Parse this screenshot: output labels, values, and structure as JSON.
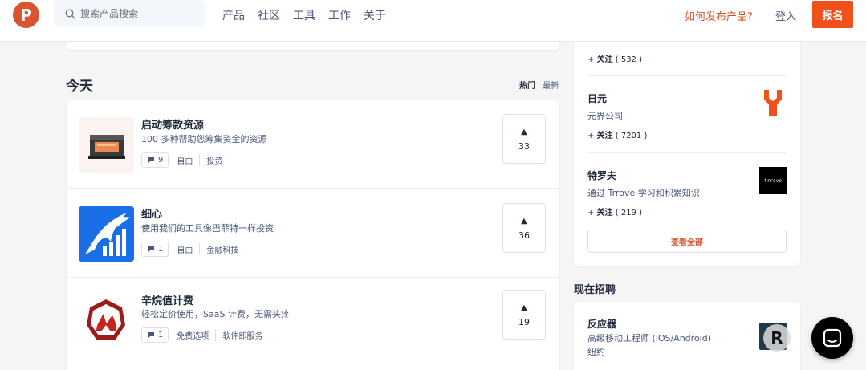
{
  "header": {
    "logo_letter": "P",
    "search_placeholder": "搜索产品搜索",
    "nav": [
      "产品",
      "社区",
      "工具",
      "工作",
      "关于"
    ],
    "how_to_post": "如何发布产品?",
    "login": "登入",
    "signup": "报名"
  },
  "feed": {
    "title": "今天",
    "sort_hot": "热门",
    "sort_new": "最新",
    "items": [
      {
        "title": "启动筹款资源",
        "desc": "100 多种帮助您筹集资金的资源",
        "comments": "9",
        "tags": [
          "自由",
          "投资"
        ],
        "votes": "33"
      },
      {
        "title": "细心",
        "desc": "使用我们的工具像巴菲特一样投资",
        "comments": "1",
        "tags": [
          "自由",
          "金融科技"
        ],
        "votes": "36"
      },
      {
        "title": "辛烷值计费",
        "desc": "轻松定价使用，SaaS 计费，无需头疼",
        "comments": "1",
        "tags": [
          "免费选项",
          "软件即服务"
        ],
        "votes": "19"
      }
    ]
  },
  "sidebar": {
    "follow_label": "关注",
    "top_follow_count": "( 532 )",
    "makers": [
      {
        "name": "日元",
        "desc": "元界公司",
        "follow_count": "( 7201 )"
      },
      {
        "name": "特罗夫",
        "desc": "通过 Trrove 学习和积累知识",
        "follow_count": "( 219 )",
        "logo_text": "trrove"
      }
    ],
    "see_all": "查看全部"
  },
  "jobs": {
    "title": "现在招聘",
    "items": [
      {
        "company": "反应器",
        "role": "高级移动工程师 (iOS/Android)",
        "location": "纽约",
        "logo_letter": "R"
      }
    ]
  },
  "colors": {
    "accent": "#da552f",
    "signup": "#f0501a"
  }
}
